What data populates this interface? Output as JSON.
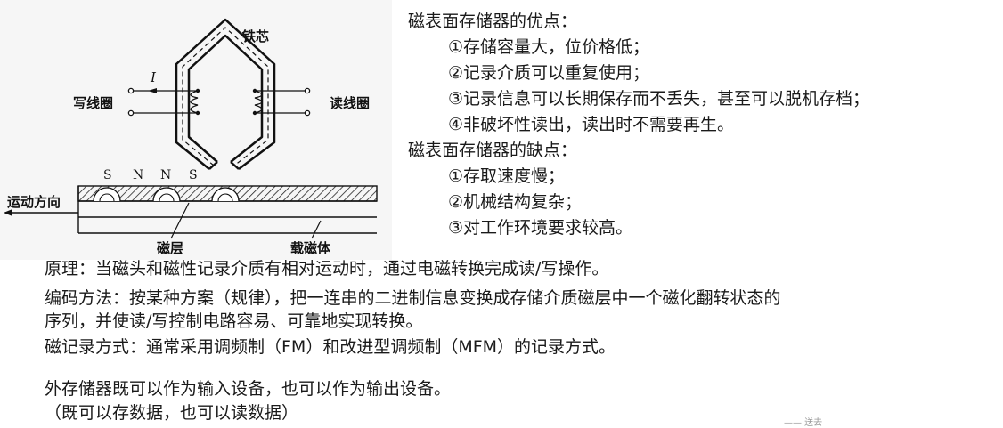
{
  "diagram": {
    "core_label": "铁芯",
    "write_coil_label": "写线圈",
    "read_coil_label": "读线圈",
    "current_label": "I",
    "direction_label": "运动方向",
    "layer_label": "磁层",
    "substrate_label": "载磁体",
    "poles": [
      "S",
      "N",
      "N",
      "S"
    ]
  },
  "advantages": {
    "heading": "磁表面存储器的优点：",
    "items": [
      "①存储容量大，位价格低；",
      "②记录介质可以重复使用；",
      "③记录信息可以长期保存而不丢失，甚至可以脱机存档；",
      "④非破坏性读出，读出时不需要再生。"
    ]
  },
  "disadvantages": {
    "heading": "磁表面存储器的缺点：",
    "items": [
      "①存取速度慢；",
      "②机械结构复杂；",
      "③对工作环境要求较高。"
    ]
  },
  "body": {
    "principle": "原理：当磁头和磁性记录介质有相对运动时，通过电磁转换完成读/写操作。",
    "encoding_line1": "编码方法：按某种方案（规律），把一连串的二进制信息变换成存储介质磁层中一个磁化翻转状态的",
    "encoding_line2": "序列，并使读/写控制电路容易、可靠地实现转换。",
    "recording": "磁记录方式：通常采用调频制（FM）和改进型调频制（MFM）的记录方式。",
    "external_line1": "外存储器既可以作为输入设备，也可以作为输出设备。",
    "external_line2": "（既可以存数据，也可以读数据）"
  },
  "footer_stub": "—— 送去"
}
